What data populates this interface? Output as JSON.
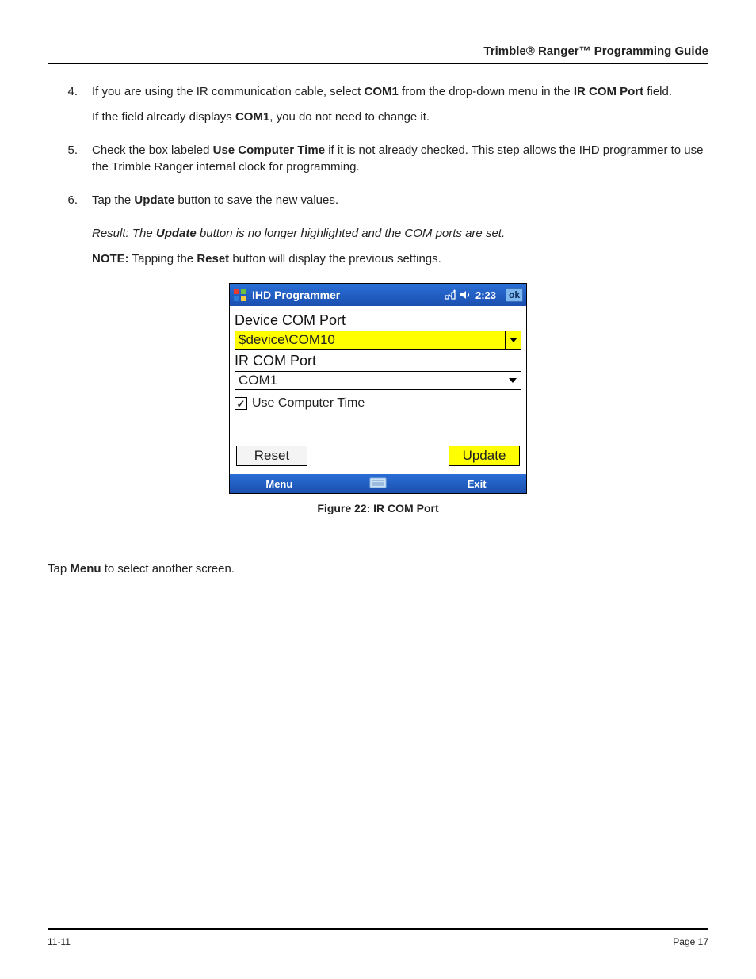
{
  "header": {
    "title": "Trimble® Ranger™ Programming Guide"
  },
  "steps": {
    "s4": {
      "num": "4.",
      "pre": "If you are using the IR communication cable, select ",
      "bold1": "COM1",
      "mid": " from the drop-down menu in the ",
      "bold2": "IR COM Port",
      "post": " field.",
      "line2_pre": "If the field already displays ",
      "line2_bold": "COM1",
      "line2_post": ", you do not need to change it."
    },
    "s5": {
      "num": "5.",
      "pre": "Check the box labeled ",
      "bold1": "Use Computer Time",
      "post": " if it is not already checked. This step allows the IHD programmer to use the Trimble Ranger internal clock for programming."
    },
    "s6": {
      "num": "6.",
      "pre": "Tap the ",
      "bold1": "Update",
      "post": " button to save the new values."
    }
  },
  "result": {
    "pre": "Result: The ",
    "bold": "Update",
    "post": " button is no longer highlighted and the COM ports are set."
  },
  "note": {
    "label": "NOTE:",
    "pre": " Tapping the ",
    "bold": "Reset",
    "post": " button will display the previous settings."
  },
  "device": {
    "title": "IHD Programmer",
    "time": "2:23",
    "ok": "ok",
    "label_device_com": "Device COM Port",
    "value_device_com": "$device\\COM10",
    "label_ir_com": "IR COM Port",
    "value_ir_com": "COM1",
    "checkbox_label": "Use Computer Time",
    "checkbox_checked": "✓",
    "btn_reset": "Reset",
    "btn_update": "Update",
    "menu": "Menu",
    "exit": "Exit"
  },
  "figure": {
    "caption": "Figure 22:  IR COM Port"
  },
  "after": {
    "pre": "Tap ",
    "bold": "Menu",
    "post": " to select another screen."
  },
  "footer": {
    "left": "11-11",
    "right": "Page 17"
  }
}
